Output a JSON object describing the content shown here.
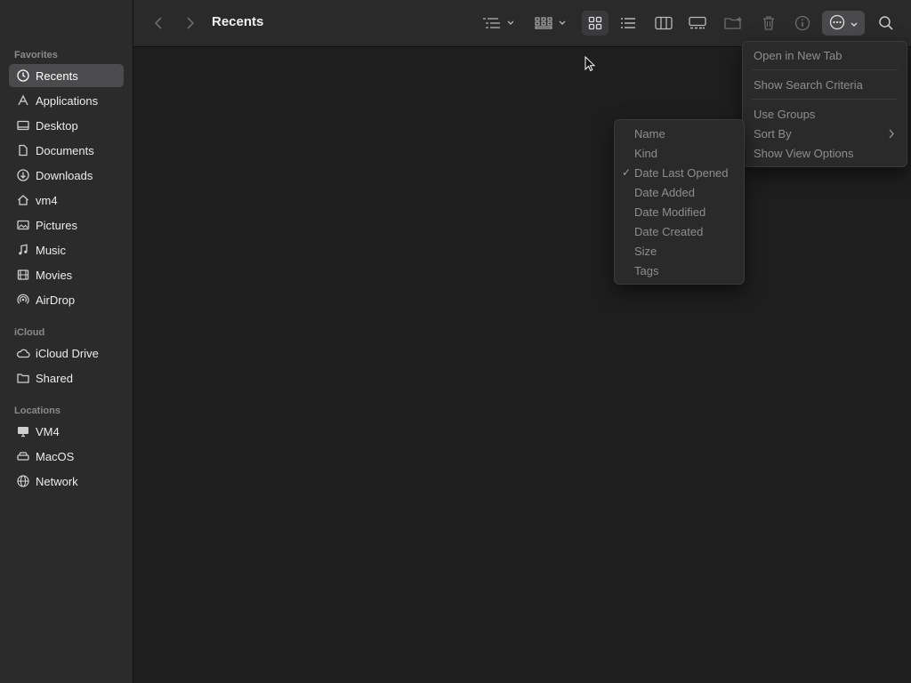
{
  "window": {
    "title": "Recents"
  },
  "sidebar": {
    "sections": [
      {
        "title": "Favorites",
        "items": [
          {
            "label": "Recents",
            "icon": "clock-icon",
            "selected": true
          },
          {
            "label": "Applications",
            "icon": "applications-icon"
          },
          {
            "label": "Desktop",
            "icon": "desktop-icon"
          },
          {
            "label": "Documents",
            "icon": "document-icon"
          },
          {
            "label": "Downloads",
            "icon": "download-icon"
          },
          {
            "label": "vm4",
            "icon": "home-icon"
          },
          {
            "label": "Pictures",
            "icon": "photo-icon"
          },
          {
            "label": "Music",
            "icon": "music-note-icon"
          },
          {
            "label": "Movies",
            "icon": "film-icon"
          },
          {
            "label": "AirDrop",
            "icon": "airdrop-icon"
          }
        ]
      },
      {
        "title": "iCloud",
        "items": [
          {
            "label": "iCloud Drive",
            "icon": "cloud-icon"
          },
          {
            "label": "Shared",
            "icon": "shared-folder-icon"
          }
        ]
      },
      {
        "title": "Locations",
        "items": [
          {
            "label": "VM4",
            "icon": "computer-icon"
          },
          {
            "label": "MacOS",
            "icon": "disk-icon"
          },
          {
            "label": "Network",
            "icon": "globe-icon"
          }
        ]
      }
    ]
  },
  "action_menu": {
    "items": [
      "Open in New Tab",
      "Show Search Criteria",
      "Use Groups",
      "Sort By",
      "Show View Options"
    ]
  },
  "sort_menu": {
    "items": [
      "Name",
      "Kind",
      "Date Last Opened",
      "Date Added",
      "Date Modified",
      "Date Created",
      "Size",
      "Tags"
    ],
    "checked": "Date Last Opened"
  },
  "colors": {
    "selection": "#4b4b4d",
    "menu_text": "#8e8e8e"
  }
}
